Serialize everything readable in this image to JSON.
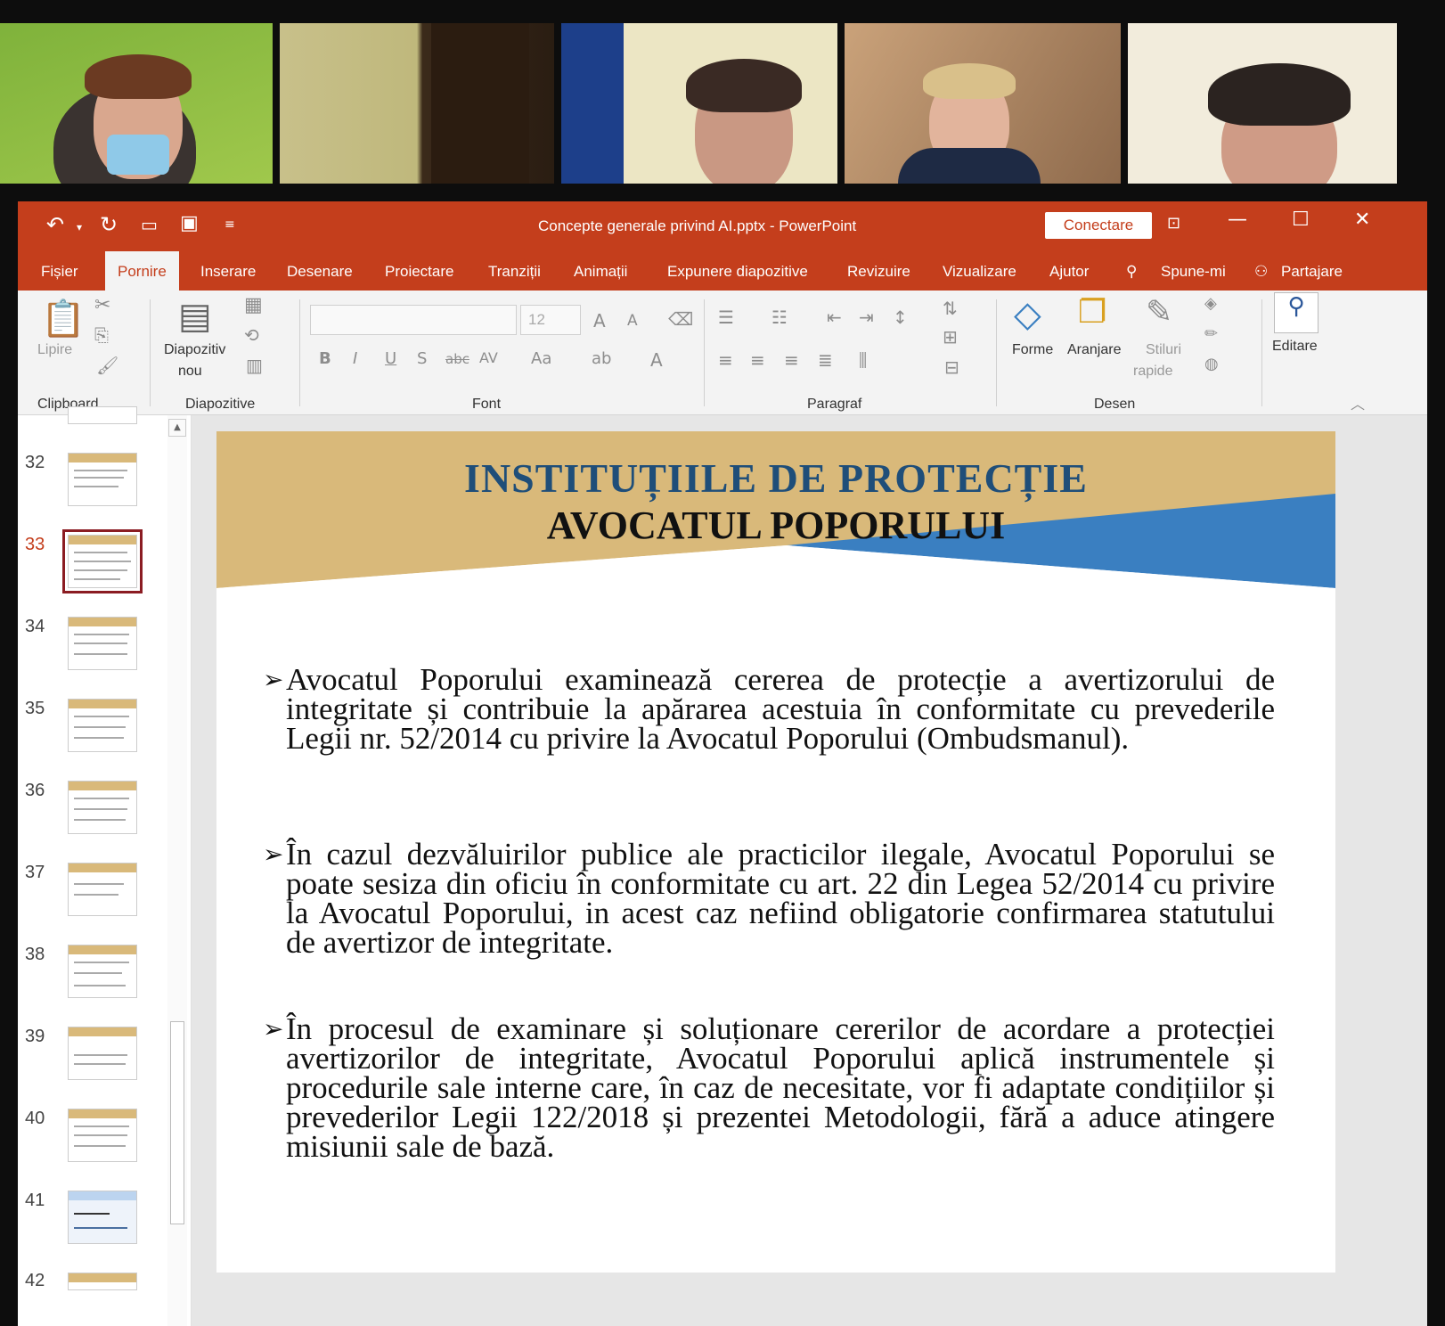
{
  "window": {
    "title": "Concepte generale privind AI.pptx  -  PowerPoint",
    "connect_label": "Conectare"
  },
  "tabs": [
    "Fișier",
    "Pornire",
    "Inserare",
    "Desenare",
    "Proiectare",
    "Tranziții",
    "Animații",
    "Expunere diapozitive",
    "Revizuire",
    "Vizualizare",
    "Ajutor",
    "Spune-mi",
    "Partajare"
  ],
  "ribbon": {
    "paste": "Lipire",
    "new_slide_1": "Diapozitiv",
    "new_slide_2": "nou",
    "font_size": "12",
    "shapes": "Forme",
    "arrange": "Aranjare",
    "quick_styles_1": "Stiluri",
    "quick_styles_2": "rapide",
    "editing": "Editare",
    "groups": [
      "Clipboard",
      "Diapozitive",
      "Font",
      "Paragraf",
      "Desen"
    ]
  },
  "slides_panel": {
    "numbers": [
      "32",
      "33",
      "34",
      "35",
      "36",
      "37",
      "38",
      "39",
      "40",
      "41",
      "42"
    ],
    "selected": "33"
  },
  "slide": {
    "title_1": "INSTITUȚIILE  DE  PROTECȚIE",
    "title_2": "AVOCATUL POPORULUI",
    "bullets": [
      "Avocatul Poporului examinează cererea de protecție a avertizorului de integritate și contribuie la apărarea acestuia în conformitate cu prevederile Legii nr. 52/2014 cu privire la Avocatul Poporului (Ombudsmanul).",
      "În cazul dezvăluirilor publice ale practicilor ilegale, Avocatul Poporului se poate sesiza din oficiu în conformitate cu art. 22 din Legea 52/2014 cu privire la Avocatul Poporului, in acest caz nefiind obligatorie confirmarea statutului de avertizor de integritate.",
      "În procesul de examinare și soluționare cererilor de acordare a protecției avertizorilor de integritate, Avocatul Poporului aplică instrumentele și procedurile sale interne care, în caz de necesitate, vor fi adaptate condițiilor și prevederilor Legii 122/2018 și prezentei Metodologii, fără a aduce atingere misiunii sale de bază."
    ]
  },
  "colors": {
    "accent": "#c43e1c",
    "slide_title": "#1f4e79",
    "band_gold": "#d9b97a",
    "band_blue": "#3a7fc1",
    "selected_thumb": "#8b1c22"
  }
}
